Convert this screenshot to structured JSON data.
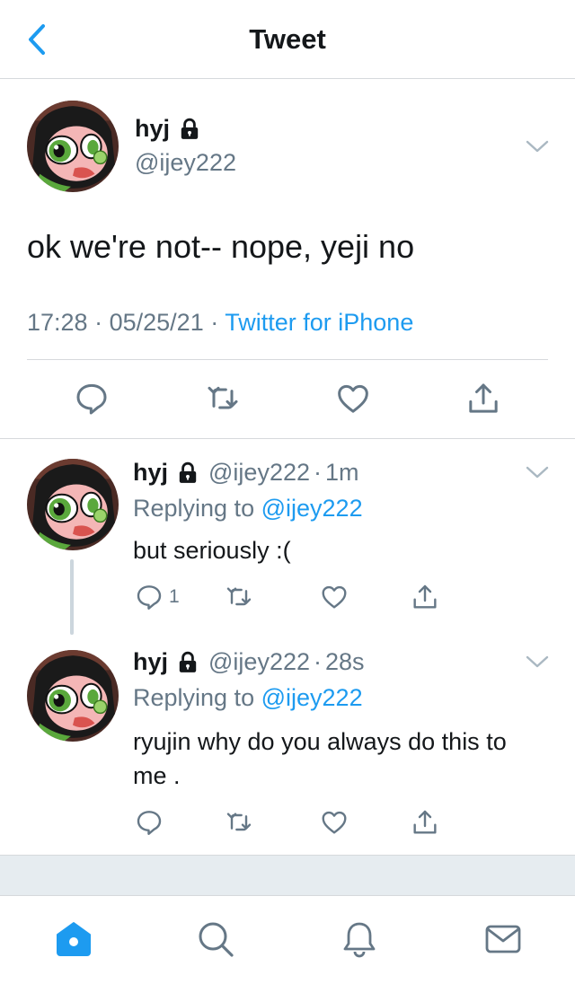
{
  "header": {
    "title": "Tweet",
    "back_icon": "chevron-left-icon"
  },
  "main_tweet": {
    "display_name": "hyj",
    "handle": "@ijey222",
    "text": "ok we're not-- nope, yeji no",
    "time": "17:28",
    "date": "05/25/21",
    "separator": "·",
    "source": "Twitter for iPhone"
  },
  "replies": [
    {
      "display_name": "hyj",
      "handle": "@ijey222",
      "separator": "·",
      "age": "1m",
      "replying_prefix": "Replying to",
      "replying_to": "@ijey222",
      "text": "but seriously :(",
      "reply_count": "1"
    },
    {
      "display_name": "hyj",
      "handle": "@ijey222",
      "separator": "·",
      "age": "28s",
      "replying_prefix": "Replying to",
      "replying_to": "@ijey222",
      "text": "ryujin why do you always do this to me .",
      "reply_count": ""
    }
  ],
  "tabs": [
    "home-icon",
    "search-icon",
    "notifications-bell-icon",
    "messages-envelope-icon"
  ],
  "colors": {
    "accent": "#1d9bf0",
    "secondary_text": "#657786",
    "divider": "#d6d9dc",
    "band": "#e6ecf0"
  }
}
